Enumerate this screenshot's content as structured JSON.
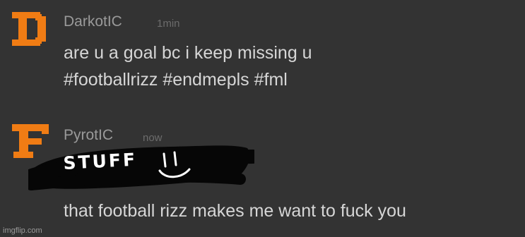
{
  "messages": [
    {
      "avatar_icon": "orange-letter-d-avatar-icon",
      "username": "DarkotIC",
      "timestamp": "1min",
      "lines": [
        "are u a goal bc i keep missing u",
        "#footballrizz #endmepls #fml"
      ]
    },
    {
      "avatar_icon": "orange-letter-f-avatar-icon",
      "username": "PyrotIC",
      "timestamp": "now",
      "scribble_text": "STUFF",
      "lines": [
        "that football rizz makes me want to fuck you"
      ]
    }
  ],
  "colors": {
    "background": "#333333",
    "avatar": "#f07c14",
    "username": "#9a9a9a",
    "timestamp": "#6c6c6c",
    "message_text": "#d6d6d6"
  },
  "watermark": "imgflip.com"
}
